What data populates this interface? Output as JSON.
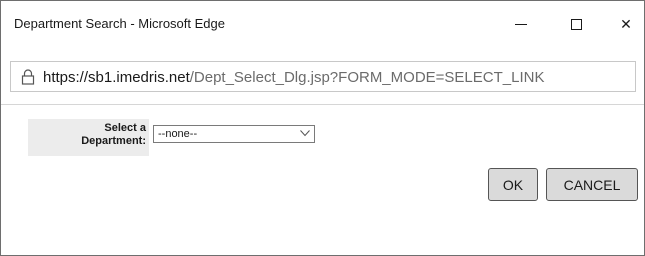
{
  "window": {
    "title": "Department Search - Microsoft Edge",
    "close_glyph": "✕"
  },
  "address_bar": {
    "host": "https://sb1.imedris.net",
    "path": "/Dept_Select_Dlg.jsp?FORM_MODE=SELECT_LINK",
    "icon": "lock-icon"
  },
  "form": {
    "label_line1": "Select a",
    "label_line2": "Department:",
    "department_select": {
      "selected": "--none--"
    }
  },
  "buttons": {
    "ok_label": "OK",
    "cancel_label": "CANCEL"
  }
}
